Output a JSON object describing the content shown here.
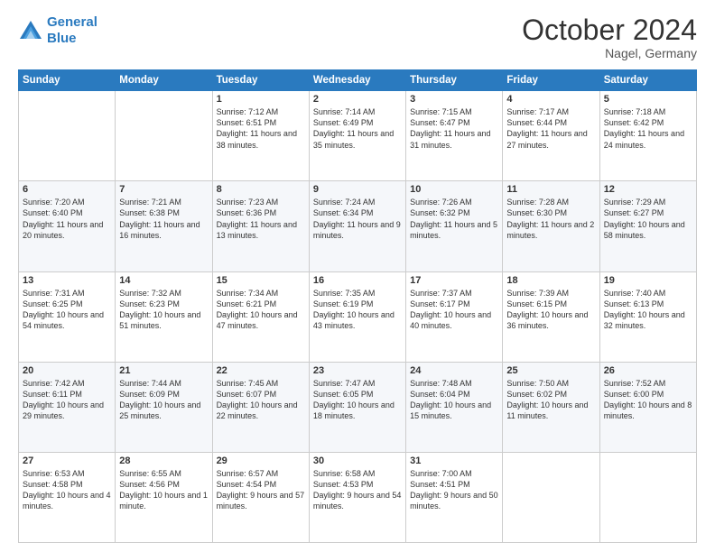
{
  "header": {
    "logo_line1": "General",
    "logo_line2": "Blue",
    "month": "October 2024",
    "location": "Nagel, Germany"
  },
  "days_of_week": [
    "Sunday",
    "Monday",
    "Tuesday",
    "Wednesday",
    "Thursday",
    "Friday",
    "Saturday"
  ],
  "weeks": [
    [
      {
        "day": "",
        "info": ""
      },
      {
        "day": "",
        "info": ""
      },
      {
        "day": "1",
        "info": "Sunrise: 7:12 AM\nSunset: 6:51 PM\nDaylight: 11 hours and 38 minutes."
      },
      {
        "day": "2",
        "info": "Sunrise: 7:14 AM\nSunset: 6:49 PM\nDaylight: 11 hours and 35 minutes."
      },
      {
        "day": "3",
        "info": "Sunrise: 7:15 AM\nSunset: 6:47 PM\nDaylight: 11 hours and 31 minutes."
      },
      {
        "day": "4",
        "info": "Sunrise: 7:17 AM\nSunset: 6:44 PM\nDaylight: 11 hours and 27 minutes."
      },
      {
        "day": "5",
        "info": "Sunrise: 7:18 AM\nSunset: 6:42 PM\nDaylight: 11 hours and 24 minutes."
      }
    ],
    [
      {
        "day": "6",
        "info": "Sunrise: 7:20 AM\nSunset: 6:40 PM\nDaylight: 11 hours and 20 minutes."
      },
      {
        "day": "7",
        "info": "Sunrise: 7:21 AM\nSunset: 6:38 PM\nDaylight: 11 hours and 16 minutes."
      },
      {
        "day": "8",
        "info": "Sunrise: 7:23 AM\nSunset: 6:36 PM\nDaylight: 11 hours and 13 minutes."
      },
      {
        "day": "9",
        "info": "Sunrise: 7:24 AM\nSunset: 6:34 PM\nDaylight: 11 hours and 9 minutes."
      },
      {
        "day": "10",
        "info": "Sunrise: 7:26 AM\nSunset: 6:32 PM\nDaylight: 11 hours and 5 minutes."
      },
      {
        "day": "11",
        "info": "Sunrise: 7:28 AM\nSunset: 6:30 PM\nDaylight: 11 hours and 2 minutes."
      },
      {
        "day": "12",
        "info": "Sunrise: 7:29 AM\nSunset: 6:27 PM\nDaylight: 10 hours and 58 minutes."
      }
    ],
    [
      {
        "day": "13",
        "info": "Sunrise: 7:31 AM\nSunset: 6:25 PM\nDaylight: 10 hours and 54 minutes."
      },
      {
        "day": "14",
        "info": "Sunrise: 7:32 AM\nSunset: 6:23 PM\nDaylight: 10 hours and 51 minutes."
      },
      {
        "day": "15",
        "info": "Sunrise: 7:34 AM\nSunset: 6:21 PM\nDaylight: 10 hours and 47 minutes."
      },
      {
        "day": "16",
        "info": "Sunrise: 7:35 AM\nSunset: 6:19 PM\nDaylight: 10 hours and 43 minutes."
      },
      {
        "day": "17",
        "info": "Sunrise: 7:37 AM\nSunset: 6:17 PM\nDaylight: 10 hours and 40 minutes."
      },
      {
        "day": "18",
        "info": "Sunrise: 7:39 AM\nSunset: 6:15 PM\nDaylight: 10 hours and 36 minutes."
      },
      {
        "day": "19",
        "info": "Sunrise: 7:40 AM\nSunset: 6:13 PM\nDaylight: 10 hours and 32 minutes."
      }
    ],
    [
      {
        "day": "20",
        "info": "Sunrise: 7:42 AM\nSunset: 6:11 PM\nDaylight: 10 hours and 29 minutes."
      },
      {
        "day": "21",
        "info": "Sunrise: 7:44 AM\nSunset: 6:09 PM\nDaylight: 10 hours and 25 minutes."
      },
      {
        "day": "22",
        "info": "Sunrise: 7:45 AM\nSunset: 6:07 PM\nDaylight: 10 hours and 22 minutes."
      },
      {
        "day": "23",
        "info": "Sunrise: 7:47 AM\nSunset: 6:05 PM\nDaylight: 10 hours and 18 minutes."
      },
      {
        "day": "24",
        "info": "Sunrise: 7:48 AM\nSunset: 6:04 PM\nDaylight: 10 hours and 15 minutes."
      },
      {
        "day": "25",
        "info": "Sunrise: 7:50 AM\nSunset: 6:02 PM\nDaylight: 10 hours and 11 minutes."
      },
      {
        "day": "26",
        "info": "Sunrise: 7:52 AM\nSunset: 6:00 PM\nDaylight: 10 hours and 8 minutes."
      }
    ],
    [
      {
        "day": "27",
        "info": "Sunrise: 6:53 AM\nSunset: 4:58 PM\nDaylight: 10 hours and 4 minutes."
      },
      {
        "day": "28",
        "info": "Sunrise: 6:55 AM\nSunset: 4:56 PM\nDaylight: 10 hours and 1 minute."
      },
      {
        "day": "29",
        "info": "Sunrise: 6:57 AM\nSunset: 4:54 PM\nDaylight: 9 hours and 57 minutes."
      },
      {
        "day": "30",
        "info": "Sunrise: 6:58 AM\nSunset: 4:53 PM\nDaylight: 9 hours and 54 minutes."
      },
      {
        "day": "31",
        "info": "Sunrise: 7:00 AM\nSunset: 4:51 PM\nDaylight: 9 hours and 50 minutes."
      },
      {
        "day": "",
        "info": ""
      },
      {
        "day": "",
        "info": ""
      }
    ]
  ]
}
